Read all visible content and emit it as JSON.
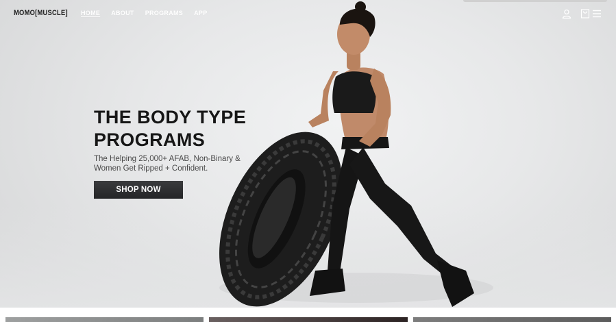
{
  "brand": {
    "logo_text": "MOMO[MUSCLE]"
  },
  "nav": {
    "links": [
      {
        "label": "HOME",
        "active": true
      },
      {
        "label": "ABOUT",
        "active": false
      },
      {
        "label": "PROGRAMS",
        "active": false
      },
      {
        "label": "APP",
        "active": false
      }
    ],
    "icons": [
      "account-icon",
      "cart-icon",
      "menu-icon"
    ]
  },
  "hero": {
    "headline_line1": "THE BODY TYPE",
    "headline_line2": "PROGRAMS",
    "subhead": "The Helping 25,000+ AFAB, Non-Binary & Women Get Ripped + Confident.",
    "cta_label": "SHOP NOW"
  },
  "colors": {
    "button_bg": "#2f3032",
    "headline": "#161616",
    "nav_text": "#ffffff",
    "background": "#e7e8e9"
  }
}
